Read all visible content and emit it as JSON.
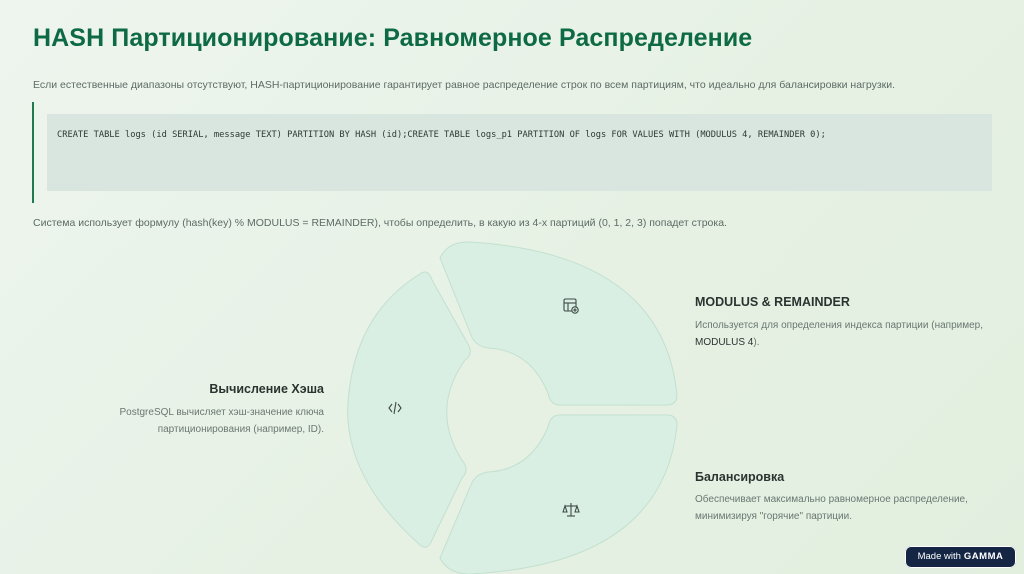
{
  "title": "HASH Партиционирование: Равномерное Распределение",
  "intro": "Если естественные диапазоны отсутствуют, HASH-партиционирование гарантирует равное распределение строк по всем партициям, что идеально для балансировки нагрузки.",
  "code": "CREATE TABLE logs (id SERIAL, message TEXT) PARTITION BY HASH (id);CREATE TABLE logs_p1 PARTITION OF logs FOR VALUES WITH (MODULUS 4, REMAINDER 0);",
  "formula_text": "Система использует формулу (hash(key) % MODULUS = REMAINDER), чтобы определить, в какую из 4-х партиций (0, 1, 2, 3) попадет строка.",
  "blocks": {
    "modulus": {
      "title": "MODULUS & REMAINDER",
      "text_pre": "Используется для определения индекса партиции (например,",
      "text_strong": "MODULUS 4",
      "text_post": ")."
    },
    "hash": {
      "title": "Вычисление Хэша",
      "text_line1": "PostgreSQL вычисляет хэш-значение ключа",
      "text_line2": "партиционирования (например, ID)."
    },
    "balance": {
      "title": "Балансировка",
      "text_line1": "Обеспечивает максимально равномерное распределение,",
      "text_line2": "минимизируя \"горячие\" партиции."
    }
  },
  "icons": {
    "top": "table-settings-icon",
    "left": "code-icon",
    "bottom": "scales-icon"
  },
  "colors": {
    "title": "#0e6a45",
    "segment_fill": "#d9efe3",
    "segment_stroke": "#c3e0cf",
    "badge": "#152645"
  },
  "badge": {
    "prefix": "Made with",
    "brand": "GAMMA"
  }
}
